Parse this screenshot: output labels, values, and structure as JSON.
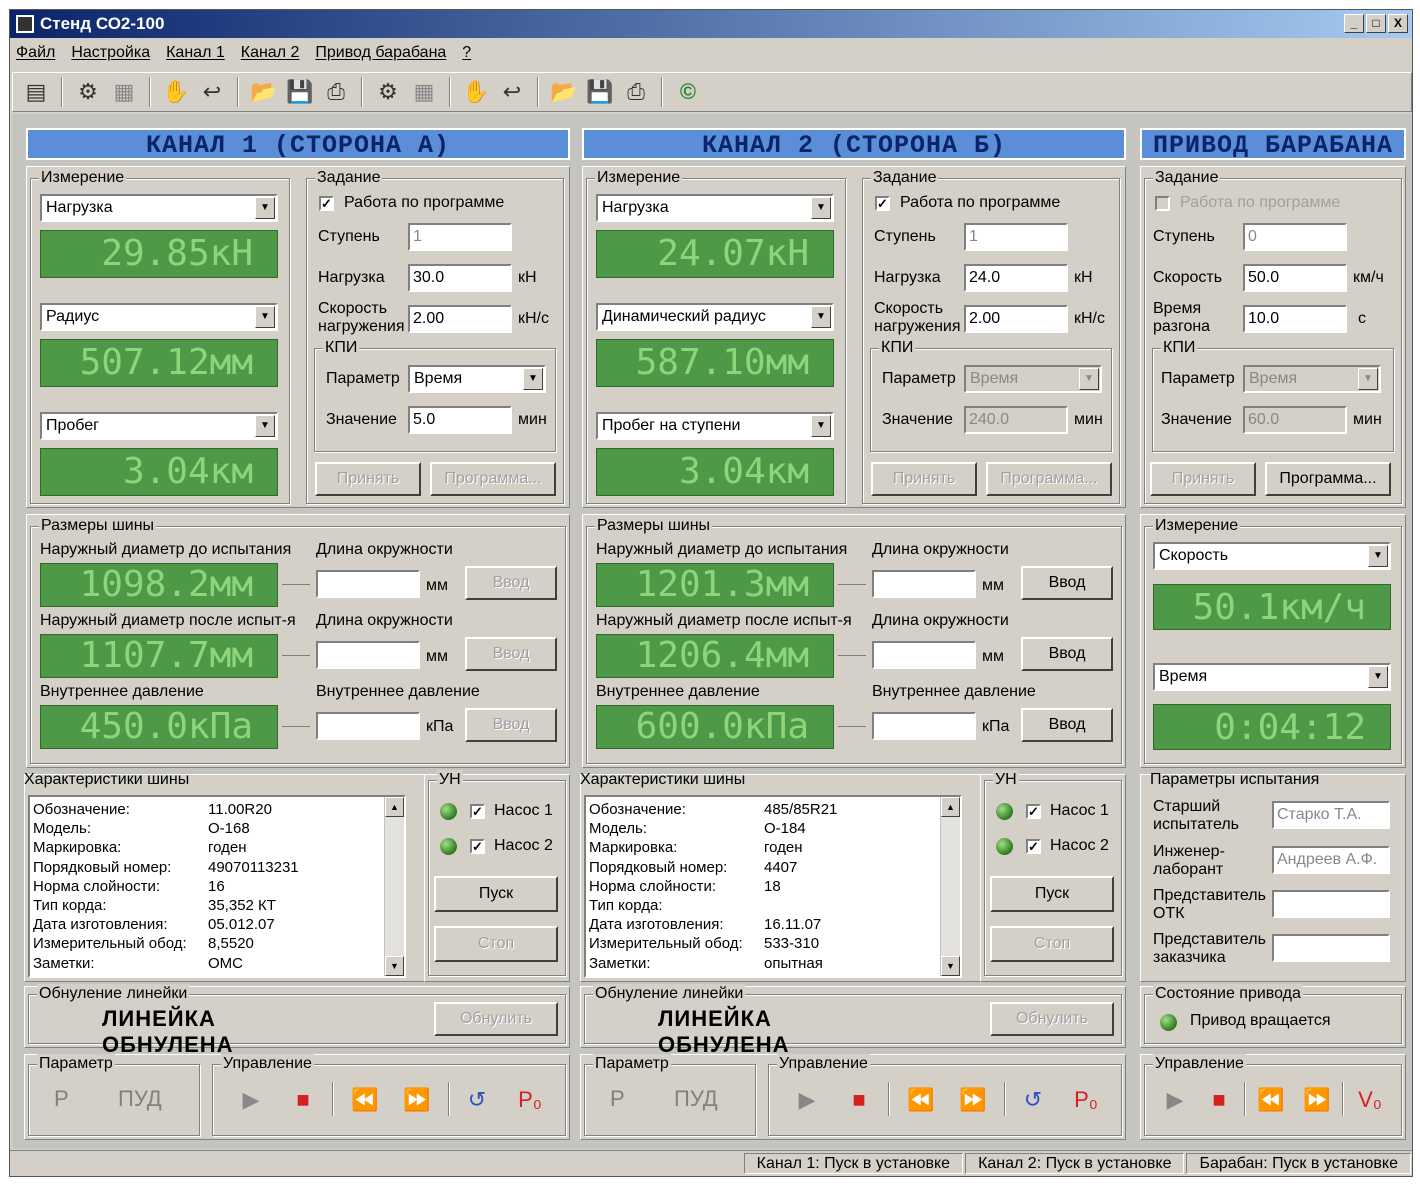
{
  "window": {
    "title": "Стенд СО2-100",
    "min": "_",
    "max": "□",
    "close": "X"
  },
  "menu": [
    "Файл",
    "Настройка",
    "Канал 1",
    "Канал 2",
    "Привод барабана",
    "?"
  ],
  "ch1": {
    "header": "КАНАЛ 1 (СТОРОНА А)",
    "meas_label": "Измерение",
    "combo1": "Нагрузка",
    "lcd1": "29.85кН",
    "combo2": "Радиус",
    "lcd2": "507.12мм",
    "combo3": "Пробег",
    "lcd3": "3.04км",
    "task_label": "Задание",
    "program_chk": "Работа по программе",
    "step_label": "Ступень",
    "step_val": "1",
    "load_label": "Нагрузка",
    "load_val": "30.0",
    "load_unit": "кН",
    "speed_label1": "Скорость",
    "speed_label2": "нагружения",
    "speed_val": "2.00",
    "speed_unit": "кН/с",
    "kpi_label": "КПИ",
    "param_label": "Параметр",
    "param_val": "Время",
    "value_label": "Значение",
    "value_val": "5.0",
    "value_unit": "мин",
    "accept": "Принять",
    "program": "Программа...",
    "tire_label": "Размеры шины",
    "od_before": "Наружный диаметр до испытания",
    "lcd_od_before": "1098.2мм",
    "od_after": "Наружный диаметр после испыт-я",
    "lcd_od_after": "1107.7мм",
    "pressure": "Внутреннее давление",
    "lcd_pressure": "450.0кПа",
    "circ1": "Длина окружности",
    "circ2": "Длина окружности",
    "press2": "Внутреннее давление",
    "mm1": "мм",
    "mm2": "мм",
    "kpa": "кПа",
    "enter": "Ввод",
    "char_label": "Характеристики шины",
    "chars": [
      [
        "Обозначение:",
        "11.00R20"
      ],
      [
        "Модель:",
        "О-168"
      ],
      [
        "Маркировка:",
        "годен"
      ],
      [
        "Порядковый номер:",
        "49070113231"
      ],
      [
        "Норма слойности:",
        "16"
      ],
      [
        "Тип корда:",
        "35,352 КТ"
      ],
      [
        "Дата изготовления:",
        "05.012.07"
      ],
      [
        "Измерительный обод:",
        "8,5520"
      ],
      [
        "Заметки:",
        "ОМС"
      ]
    ],
    "un_label": "УН",
    "pump1": "Насос 1",
    "pump2": "Насос 2",
    "start": "Пуск",
    "stop": "Стоп",
    "zero_label": "Обнуление линейки",
    "zero_text": "ЛИНЕЙКА ОБНУЛЕНА",
    "zero_btn": "Обнулить",
    "param_box": "Параметр",
    "p": "Р",
    "pud": "ПУД",
    "ctrl_label": "Управление"
  },
  "ch2": {
    "header": "КАНАЛ 2 (СТОРОНА Б)",
    "meas_label": "Измерение",
    "combo1": "Нагрузка",
    "lcd1": "24.07кН",
    "combo2": "Динамический радиус",
    "lcd2": "587.10мм",
    "combo3": "Пробег на ступени",
    "lcd3": "3.04км",
    "task_label": "Задание",
    "program_chk": "Работа по программе",
    "step_label": "Ступень",
    "step_val": "1",
    "load_label": "Нагрузка",
    "load_val": "24.0",
    "load_unit": "кН",
    "speed_label1": "Скорость",
    "speed_label2": "нагружения",
    "speed_val": "2.00",
    "speed_unit": "кН/с",
    "kpi_label": "КПИ",
    "param_label": "Параметр",
    "param_val": "Время",
    "value_label": "Значение",
    "value_val": "240.0",
    "value_unit": "мин",
    "accept": "Принять",
    "program": "Программа...",
    "tire_label": "Размеры шины",
    "od_before": "Наружный диаметр до испытания",
    "lcd_od_before": "1201.3мм",
    "od_after": "Наружный диаметр после испыт-я",
    "lcd_od_after": "1206.4мм",
    "pressure": "Внутреннее давление",
    "lcd_pressure": "600.0кПа",
    "circ1": "Длина окружности",
    "circ2": "Длина окружности",
    "press2": "Внутреннее давление",
    "mm1": "мм",
    "mm2": "мм",
    "kpa": "кПа",
    "enter": "Ввод",
    "char_label": "Характеристики шины",
    "chars": [
      [
        "Обозначение:",
        "485/85R21"
      ],
      [
        "Модель:",
        "О-184"
      ],
      [
        "Маркировка:",
        "годен"
      ],
      [
        "Порядковый номер:",
        "4407"
      ],
      [
        "Норма слойности:",
        "18"
      ],
      [
        "Тип корда:",
        ""
      ],
      [
        "Дата изготовления:",
        "16.11.07"
      ],
      [
        "Измерительный обод:",
        "533-310"
      ],
      [
        "Заметки:",
        "опытная"
      ]
    ],
    "un_label": "УН",
    "pump1": "Насос 1",
    "pump2": "Насос 2",
    "start": "Пуск",
    "stop": "Стоп",
    "zero_label": "Обнуление линейки",
    "zero_text": "ЛИНЕЙКА ОБНУЛЕНА",
    "zero_btn": "Обнулить",
    "param_box": "Параметр",
    "p": "Р",
    "pud": "ПУД",
    "ctrl_label": "Управление"
  },
  "drum": {
    "header": "ПРИВОД БАРАБАНА",
    "task_label": "Задание",
    "program_chk": "Работа по программе",
    "step_label": "Ступень",
    "step_val": "0",
    "speed_label": "Скорость",
    "speed_val": "50.0",
    "speed_unit": "км/ч",
    "time_label1": "Время",
    "time_label2": "разгона",
    "time_val": "10.0",
    "time_unit": "с",
    "kpi_label": "КПИ",
    "param_label": "Параметр",
    "param_val": "Время",
    "value_label": "Значение",
    "value_val": "60.0",
    "value_unit": "мин",
    "accept": "Принять",
    "program": "Программа...",
    "meas_label": "Измерение",
    "combo1": "Скорость",
    "lcd1": "50.1км/ч",
    "combo2": "Время",
    "lcd2": "0:04:12",
    "test_label": "Параметры испытания",
    "senior1": "Старший",
    "senior2": "испытатель",
    "senior_val": "Старко Т.А.",
    "eng1": "Инженер-",
    "eng2": "лаборант",
    "eng_val": "Андреев А.Ф.",
    "otk1": "Представитель",
    "otk2": "ОТК",
    "cust1": "Представитель",
    "cust2": "заказчика",
    "state_label": "Состояние привода",
    "state_text": "Привод вращается",
    "ctrl_label": "Управление"
  },
  "status": [
    "Канал 1: Пуск в установке",
    "Канал 2: Пуск в установке",
    "Барабан: Пуск в установке"
  ],
  "icons": {
    "play": "▶",
    "stop": "■",
    "rew": "⏪",
    "ff": "⏩",
    "reset": "↺",
    "p0": "P₀",
    "v0": "V₀",
    "copyright": "©"
  }
}
